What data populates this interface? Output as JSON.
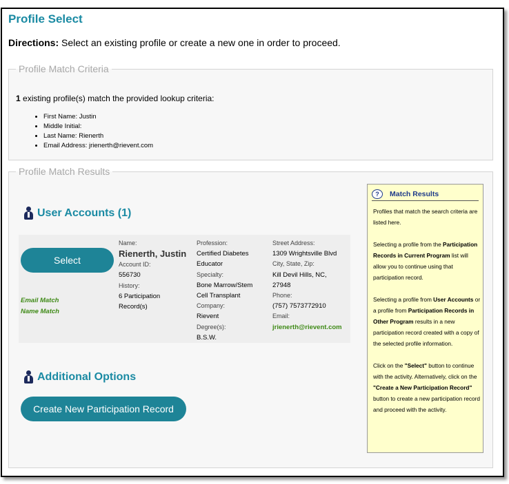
{
  "page_title": "Profile Select",
  "directions": {
    "label": "Directions:",
    "text": "Select an existing profile or create a new one in order to proceed."
  },
  "criteria": {
    "legend": "Profile Match Criteria",
    "count": "1",
    "intro": "existing profile(s) match the provided lookup criteria:",
    "items": [
      "First Name: Justin",
      "Middle Initial:",
      "Last Name: Rienerth",
      "Email Address: jrienerth@rievent.com"
    ]
  },
  "results": {
    "legend": "Profile Match Results",
    "user_accounts_heading": "User Accounts (1)",
    "select_label": "Select",
    "match_flags": [
      "Email Match",
      "Name Match"
    ],
    "account": {
      "name_label": "Name:",
      "name": "Rienerth, Justin",
      "account_id_label": "Account ID:",
      "account_id": "556730",
      "history_label": "History:",
      "history_line1": "6 Participation",
      "history_line2": "Record(s)",
      "profession_label": "Profession:",
      "profession_line1": "Certified Diabetes",
      "profession_line2": "Educator",
      "specialty_label": "Specialty:",
      "specialty_line1": "Bone Marrow/Stem",
      "specialty_line2": "Cell Transplant",
      "company_label": "Company:",
      "company": "Rievent",
      "degree_label": "Degree(s):",
      "degree": "B.S.W.",
      "street_label": "Street Address:",
      "street": "1309 Wrightsville Blvd",
      "city_label": "City, State, Zip:",
      "city_line1": "Kill Devil Hills, NC,",
      "city_line2": "27948",
      "phone_label": "Phone:",
      "phone": "(757) 7573772910",
      "email_label": "Email:",
      "email": "jrienerth@rievent.com"
    },
    "additional_heading": "Additional Options",
    "create_label": "Create New Participation Record"
  },
  "help": {
    "title": "Match Results",
    "p1": "Profiles that match the search criteria are listed here.",
    "p2_a": "Selecting a profile from the ",
    "p2_b": "Participation Records in Current Program",
    "p2_c": " list will allow you to continue using that participation record.",
    "p3_a": "Selecting a profile from ",
    "p3_b": "User Accounts",
    "p3_c": " or a profile from ",
    "p3_d": "Participation Records in Other Program",
    "p3_e": " results in a new participation record created with a copy of the selected profile information.",
    "p4_a": "Click on the ",
    "p4_b": "\"Select\"",
    "p4_c": " button to continue with the activity. Alternatively, click on the ",
    "p4_d": "\"Create a New Participation Record\"",
    "p4_e": " button to create a new participation record and proceed with the activity."
  }
}
